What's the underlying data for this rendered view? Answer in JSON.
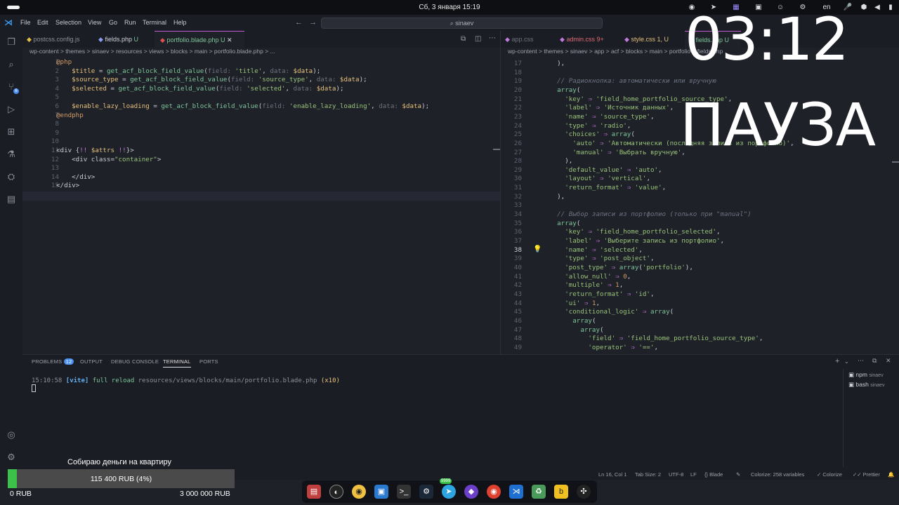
{
  "system": {
    "clock": "Сб, 3 января  15:19",
    "lang": "en",
    "tray_icons": [
      "chrome-icon",
      "telegram-icon",
      "grid-icon",
      "terminal-icon",
      "discord-icon",
      "steam-icon",
      "user-icon",
      "mic-icon",
      "volume-icon",
      "network-icon",
      "battery-icon"
    ]
  },
  "menu": {
    "items": [
      "File",
      "Edit",
      "Selection",
      "View",
      "Go",
      "Run",
      "Terminal",
      "Help"
    ],
    "search": "sinaev"
  },
  "left_tabs": [
    {
      "label": "postcss.config.js",
      "status": ""
    },
    {
      "label": "fields.php",
      "status": "U"
    },
    {
      "label": "portfolio.blade.php",
      "status": "U"
    }
  ],
  "left_breadcrumb": "wp-content  >  themes  >  sinaev  >  resources  >  views  >  blocks  >  main  >  portfolio.blade.php  >  ...",
  "right_tabs": [
    {
      "label": "app.css",
      "status": ""
    },
    {
      "label": "admin.css",
      "status": "9+"
    },
    {
      "label": "style.css",
      "status": "1, U"
    },
    {
      "label": "fields.php",
      "status": "U"
    }
  ],
  "right_breadcrumb": "wp-content  >  themes  >  sinaev  >  app  >  acf  >  blocks  >  main  >  portfolio  >  fields.php",
  "left_code": [
    {
      "n": "1",
      "html": "<span class='tagc'>@php</span>"
    },
    {
      "n": "2",
      "html": "    <span class='var'>$title</span> = <span class='fn'>get_acf_block_field_value</span>(<span class='hint'>field: </span><span class='str'>'title'</span>, <span class='hint'>data: </span><span class='var'>$data</span>);"
    },
    {
      "n": "3",
      "html": "    <span class='var'>$source_type</span> = <span class='fn'>get_acf_block_field_value</span>(<span class='hint'>field: </span><span class='str'>'source_type'</span>, <span class='hint'>data: </span><span class='var'>$data</span>);"
    },
    {
      "n": "4",
      "html": "    <span class='var'>$selected</span> = <span class='fn'>get_acf_block_field_value</span>(<span class='hint'>field: </span><span class='str'>'selected'</span>, <span class='hint'>data: </span><span class='var'>$data</span>);"
    },
    {
      "n": "5",
      "html": ""
    },
    {
      "n": "6",
      "html": "    <span class='var'>$enable_lazy_loading</span> = <span class='fn'>get_acf_block_field_value</span>(<span class='hint'>field: </span><span class='str'>'enable_lazy_loading'</span>, <span class='hint'>data: </span><span class='var'>$data</span>);"
    },
    {
      "n": "7",
      "html": "<span class='tagc'>@endphp</span>"
    },
    {
      "n": "8",
      "html": ""
    },
    {
      "n": "9",
      "html": ""
    },
    {
      "n": "10",
      "html": ""
    },
    {
      "n": "11",
      "html": "&lt;div {<span class='kw'>!!</span> <span class='var'>$attrs</span> <span class='kw'>!!</span>}&gt;"
    },
    {
      "n": "12",
      "html": "    &lt;div class=<span class='str'>\"container\"</span>&gt;"
    },
    {
      "n": "13",
      "html": ""
    },
    {
      "n": "14",
      "html": "    &lt;/div&gt;"
    },
    {
      "n": "15",
      "html": "&lt;/div&gt;"
    },
    {
      "n": "16",
      "html": ""
    }
  ],
  "right_code": [
    {
      "n": "17",
      "html": "    ),"
    },
    {
      "n": "18",
      "html": ""
    },
    {
      "n": "19",
      "html": "    <span class='cm'>// Радиокнопка: автоматически или вручную</span>"
    },
    {
      "n": "20",
      "html": "    <span class='fn'>array</span>("
    },
    {
      "n": "21",
      "html": "      <span class='str'>'key'</span> <span class='op'>⇒</span> <span class='str'>'field_home_portfolio_source_type'</span>,"
    },
    {
      "n": "22",
      "html": "      <span class='str'>'label'</span> <span class='op'>⇒</span> <span class='str'>'Источник данных'</span>,"
    },
    {
      "n": "23",
      "html": "      <span class='str'>'name'</span> <span class='op'>⇒</span> <span class='str'>'source_type'</span>,"
    },
    {
      "n": "24",
      "html": "      <span class='str'>'type'</span> <span class='op'>⇒</span> <span class='str'>'radio'</span>,"
    },
    {
      "n": "25",
      "html": "      <span class='str'>'choices'</span> <span class='op'>⇒</span> <span class='fn'>array</span>("
    },
    {
      "n": "26",
      "html": "        <span class='str'>'auto'</span> <span class='op'>⇒</span> <span class='str'>'Автоматически (последняя запись из портфолио)'</span>,"
    },
    {
      "n": "27",
      "html": "        <span class='str'>'manual'</span> <span class='op'>⇒</span> <span class='str'>'Выбрать вручную'</span>,"
    },
    {
      "n": "28",
      "html": "      ),"
    },
    {
      "n": "29",
      "html": "      <span class='str'>'default_value'</span> <span class='op'>⇒</span> <span class='str'>'auto'</span>,"
    },
    {
      "n": "30",
      "html": "      <span class='str'>'layout'</span> <span class='op'>⇒</span> <span class='str'>'vertical'</span>,"
    },
    {
      "n": "31",
      "html": "      <span class='str'>'return_format'</span> <span class='op'>⇒</span> <span class='str'>'value'</span>,"
    },
    {
      "n": "32",
      "html": "    ),"
    },
    {
      "n": "33",
      "html": ""
    },
    {
      "n": "34",
      "html": "    <span class='cm'>// Выбор записи из портфолио (только при \"manual\")</span>"
    },
    {
      "n": "35",
      "html": "    <span class='fn'>array</span>("
    },
    {
      "n": "36",
      "html": "      <span class='str'>'key'</span> <span class='op'>⇒</span> <span class='str'>'field_home_portfolio_selected'</span>,"
    },
    {
      "n": "37",
      "html": "      <span class='str'>'label'</span> <span class='op'>⇒</span> <span class='str'>'Выберите запись из портфолио'</span>,"
    },
    {
      "n": "38",
      "html": "      <span class='str'>'name'</span> <span class='op'>⇒</span> <span class='str'>'selected'</span>,"
    },
    {
      "n": "39",
      "html": "      <span class='str'>'type'</span> <span class='op'>⇒</span> <span class='str'>'post_object'</span>,"
    },
    {
      "n": "40",
      "html": "      <span class='str'>'post_type'</span> <span class='op'>⇒</span> <span class='fn'>array</span>(<span class='str'>'portfolio'</span>),"
    },
    {
      "n": "41",
      "html": "      <span class='str'>'allow_null'</span> <span class='op'>⇒</span> <span class='tagc'>0</span>,"
    },
    {
      "n": "42",
      "html": "      <span class='str'>'multiple'</span> <span class='op'>⇒</span> <span class='tagc'>1</span>,"
    },
    {
      "n": "43",
      "html": "      <span class='str'>'return_format'</span> <span class='op'>⇒</span> <span class='str'>'id'</span>,"
    },
    {
      "n": "44",
      "html": "      <span class='str'>'ui'</span> <span class='op'>⇒</span> <span class='tagc'>1</span>,"
    },
    {
      "n": "45",
      "html": "      <span class='str'>'conditional_logic'</span> <span class='op'>⇒</span> <span class='fn'>array</span>("
    },
    {
      "n": "46",
      "html": "        <span class='fn'>array</span>("
    },
    {
      "n": "47",
      "html": "          <span class='fn'>array</span>("
    },
    {
      "n": "48",
      "html": "            <span class='str'>'field'</span> <span class='op'>⇒</span> <span class='str'>'field_home_portfolio_source_type'</span>,"
    },
    {
      "n": "49",
      "html": "            <span class='str'>'operator'</span> <span class='op'>⇒</span> <span class='str'>'=='</span>,"
    }
  ],
  "panel": {
    "tabs": [
      "PROBLEMS",
      "OUTPUT",
      "DEBUG CONSOLE",
      "TERMINAL",
      "PORTS"
    ],
    "problems_count": "12",
    "terminal_time": "15:10:58",
    "terminal_tag": "[vite]",
    "terminal_msg": "full reload",
    "terminal_path": "resources/views/blocks/main/portfolio.blade.php",
    "terminal_count": "(x10)",
    "shells": [
      {
        "name": "npm",
        "sub": "sinaev"
      },
      {
        "name": "bash",
        "sub": "sinaev"
      }
    ]
  },
  "status": {
    "position": "Ln 16, Col 1",
    "tab_size": "Tab Size: 2",
    "encoding": "UTF-8",
    "eol": "LF",
    "language": "Blade",
    "colorize": "Colorize: 258 variables",
    "colorize2": "Colorize",
    "prettier": "Prettier"
  },
  "overlay": {
    "timer": "03:12",
    "pause": "ПАУЗА"
  },
  "donation": {
    "title": "Собираю деньги на квартиру",
    "progress_label": "115 400 RUB (4%)",
    "progress_percent": 4,
    "min": "0 RUB",
    "max": "3 000 000 RUB"
  },
  "dock_badge": "9999"
}
